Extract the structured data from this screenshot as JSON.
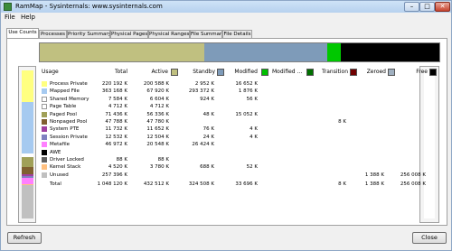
{
  "window": {
    "title": "RamMap - Sysinternals: www.sysinternals.com"
  },
  "menu": [
    "File",
    "Help"
  ],
  "tabs": [
    "Use Counts",
    "Processes",
    "Priority Summary",
    "Physical Pages",
    "Physical Ranges",
    "File Summary",
    "File Details"
  ],
  "colors": {
    "process_private": "#ffff80",
    "mapped_file": "#a6caf0",
    "shared_memory": "#ffffff",
    "page_table": "#ffffff",
    "paged_pool": "#a0a058",
    "nonpaged_pool": "#806030",
    "system_pte": "#a040a0",
    "session_private": "#8080c0",
    "metafile": "#ff80ff",
    "awe": "#000000",
    "driver_locked": "#606060",
    "kernel_stack": "#ffc080",
    "unused": "#c0c0c0",
    "active": "#c0c080",
    "standby": "#7e9bb9",
    "modified": "#00c000",
    "modified_no_write": "#007000",
    "transition": "#700000",
    "zeroed": "#a0b0c0",
    "free": "#000000",
    "topbar_standby": "#7e9bb9",
    "topbar_modified": "#00c800",
    "topbar_free": "#000000"
  },
  "columns": [
    "Usage",
    "Total",
    "Active",
    "Standby",
    "Modified",
    "Modified ...",
    "Transition",
    "Zeroed",
    "Free"
  ],
  "rows": [
    {
      "usage": "Process Private",
      "total": "220 192 K",
      "active": "200 588 K",
      "standby": "2 952 K",
      "modified": "16 652 K",
      "modnw": "",
      "transition": "",
      "zeroed": "",
      "free": ""
    },
    {
      "usage": "Mapped File",
      "total": "363 168 K",
      "active": "67 920 K",
      "standby": "293 372 K",
      "modified": "1 876 K",
      "modnw": "",
      "transition": "",
      "zeroed": "",
      "free": ""
    },
    {
      "usage": "Shared Memory",
      "total": "7 584 K",
      "active": "6 604 K",
      "standby": "924 K",
      "modified": "56 K",
      "modnw": "",
      "transition": "",
      "zeroed": "",
      "free": ""
    },
    {
      "usage": "Page Table",
      "total": "4 712 K",
      "active": "4 712 K",
      "standby": "",
      "modified": "",
      "modnw": "",
      "transition": "",
      "zeroed": "",
      "free": ""
    },
    {
      "usage": "Paged Pool",
      "total": "71 436 K",
      "active": "56 336 K",
      "standby": "48 K",
      "modified": "15 052 K",
      "modnw": "",
      "transition": "",
      "zeroed": "",
      "free": ""
    },
    {
      "usage": "Nonpaged Pool",
      "total": "47 788 K",
      "active": "47 780 K",
      "standby": "",
      "modified": "",
      "modnw": "",
      "transition": "8 K",
      "zeroed": "",
      "free": ""
    },
    {
      "usage": "System PTE",
      "total": "11 732 K",
      "active": "11 652 K",
      "standby": "76 K",
      "modified": "4 K",
      "modnw": "",
      "transition": "",
      "zeroed": "",
      "free": ""
    },
    {
      "usage": "Session Private",
      "total": "12 532 K",
      "active": "12 504 K",
      "standby": "24 K",
      "modified": "4 K",
      "modnw": "",
      "transition": "",
      "zeroed": "",
      "free": ""
    },
    {
      "usage": "Metafile",
      "total": "46 972 K",
      "active": "20 548 K",
      "standby": "26 424 K",
      "modified": "",
      "modnw": "",
      "transition": "",
      "zeroed": "",
      "free": ""
    },
    {
      "usage": "AWE",
      "total": "",
      "active": "",
      "standby": "",
      "modified": "",
      "modnw": "",
      "transition": "",
      "zeroed": "",
      "free": ""
    },
    {
      "usage": "Driver Locked",
      "total": "88 K",
      "active": "88 K",
      "standby": "",
      "modified": "",
      "modnw": "",
      "transition": "",
      "zeroed": "",
      "free": ""
    },
    {
      "usage": "Kernel Stack",
      "total": "4 520 K",
      "active": "3 780 K",
      "standby": "688 K",
      "modified": "52 K",
      "modnw": "",
      "transition": "",
      "zeroed": "",
      "free": ""
    },
    {
      "usage": "Unused",
      "total": "257 396 K",
      "active": "",
      "standby": "",
      "modified": "",
      "modnw": "",
      "transition": "",
      "zeroed": "1 388 K",
      "free": "256 008 K"
    },
    {
      "usage": "Total",
      "total": "1 048 120 K",
      "active": "432 512 K",
      "standby": "324 508 K",
      "modified": "33 696 K",
      "modnw": "",
      "transition": "8 K",
      "zeroed": "1 388 K",
      "free": "256 008 K"
    }
  ],
  "buttons": {
    "refresh": "Refresh",
    "close": "Close"
  }
}
